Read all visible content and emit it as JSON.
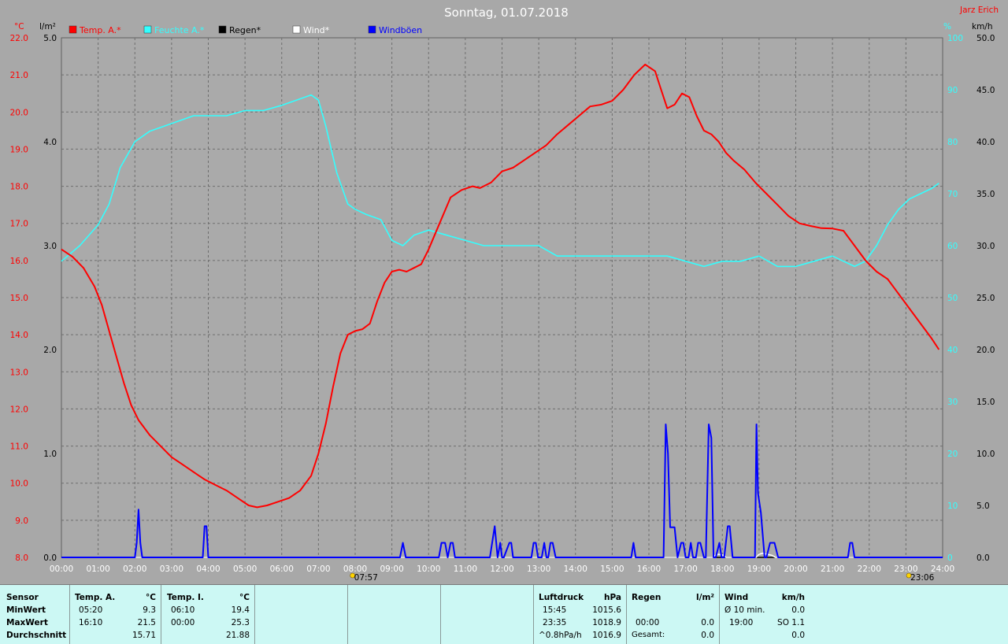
{
  "chart_data": {
    "type": "line",
    "title": "Sonntag, 01.07.2018",
    "author": "Jarz Erich",
    "x_ticks": [
      "00:00",
      "01:00",
      "02:00",
      "03:00",
      "04:00",
      "05:00",
      "06:00",
      "07:00",
      "08:00",
      "09:00",
      "10:00",
      "11:00",
      "12:00",
      "13:00",
      "14:00",
      "15:00",
      "16:00",
      "17:00",
      "18:00",
      "19:00",
      "20:00",
      "21:00",
      "22:00",
      "23:00",
      "24:00"
    ],
    "axes": {
      "temp": {
        "unit": "°C",
        "min": 8.0,
        "max": 22.0,
        "ticks": [
          "8.0",
          "9.0",
          "10.0",
          "11.0",
          "12.0",
          "13.0",
          "14.0",
          "15.0",
          "16.0",
          "17.0",
          "18.0",
          "19.0",
          "20.0",
          "21.0",
          "22.0"
        ],
        "color": "#ff0000"
      },
      "rain": {
        "unit": "l/m²",
        "min": 0.0,
        "max": 5.0,
        "ticks": [
          "0.0",
          "1.0",
          "2.0",
          "3.0",
          "4.0",
          "5.0"
        ],
        "color": "#000000"
      },
      "humidity": {
        "unit": "%",
        "ticks": [
          "0",
          "10",
          "20",
          "30",
          "40",
          "50",
          "60",
          "70",
          "80",
          "90",
          "100"
        ],
        "color": "#33ffff"
      },
      "wind": {
        "unit": "km/h",
        "min": 0.0,
        "max": 50.0,
        "ticks": [
          "0.0",
          "5.0",
          "10.0",
          "15.0",
          "20.0",
          "25.0",
          "30.0",
          "35.0",
          "40.0",
          "45.0",
          "50.0"
        ],
        "color": "#000000"
      }
    },
    "legend": [
      {
        "label": "Temp. A.*",
        "color": "#ff0000"
      },
      {
        "label": "Feuchte A.*",
        "color": "#33ffff"
      },
      {
        "label": "Regen*",
        "color": "#000000"
      },
      {
        "label": "Wind*",
        "color": "#ffffff"
      },
      {
        "label": "Windböen",
        "color": "#0000ff"
      }
    ],
    "sun": {
      "sunrise": "07:57",
      "sunset": "23:06"
    },
    "series": [
      {
        "name": "Temp. A.*",
        "color": "#ff0000",
        "axis": "temp",
        "x": [
          0,
          0.3,
          0.6,
          0.9,
          1.1,
          1.3,
          1.5,
          1.7,
          1.9,
          2.1,
          2.4,
          2.7,
          3,
          3.3,
          3.6,
          3.9,
          4.2,
          4.5,
          4.8,
          5.1,
          5.33,
          5.6,
          5.9,
          6.2,
          6.5,
          6.8,
          7,
          7.2,
          7.4,
          7.6,
          7.8,
          8,
          8.2,
          8.4,
          8.6,
          8.8,
          9,
          9.2,
          9.4,
          9.6,
          9.8,
          10,
          10.3,
          10.6,
          10.9,
          11.2,
          11.4,
          11.7,
          12,
          12.3,
          12.6,
          12.9,
          13.2,
          13.5,
          13.8,
          14.1,
          14.4,
          14.7,
          15,
          15.3,
          15.6,
          15.9,
          16.17,
          16.3,
          16.5,
          16.7,
          16.9,
          17.1,
          17.3,
          17.5,
          17.7,
          17.9,
          18.1,
          18.3,
          18.6,
          18.9,
          19.2,
          19.5,
          19.8,
          20.1,
          20.4,
          20.7,
          21,
          21.3,
          21.6,
          21.9,
          22.2,
          22.5,
          22.8,
          23.1,
          23.4,
          23.7,
          23.9
        ],
        "y": [
          16.3,
          16.1,
          15.8,
          15.3,
          14.8,
          14.1,
          13.4,
          12.7,
          12.1,
          11.7,
          11.3,
          11.0,
          10.7,
          10.5,
          10.3,
          10.1,
          9.95,
          9.8,
          9.6,
          9.4,
          9.35,
          9.4,
          9.5,
          9.6,
          9.8,
          10.2,
          10.8,
          11.6,
          12.6,
          13.5,
          14.0,
          14.1,
          14.15,
          14.3,
          14.9,
          15.4,
          15.7,
          15.75,
          15.7,
          15.8,
          15.9,
          16.3,
          17.0,
          17.7,
          17.9,
          18.0,
          17.95,
          18.1,
          18.4,
          18.5,
          18.7,
          18.9,
          19.1,
          19.4,
          19.65,
          19.9,
          20.15,
          20.2,
          20.3,
          20.6,
          21.0,
          21.28,
          21.1,
          20.7,
          20.1,
          20.2,
          20.5,
          20.4,
          19.9,
          19.5,
          19.4,
          19.2,
          18.9,
          18.7,
          18.45,
          18.1,
          17.8,
          17.5,
          17.2,
          17.0,
          16.93,
          16.87,
          16.86,
          16.8,
          16.4,
          16.0,
          15.7,
          15.5,
          15.1,
          14.7,
          14.3,
          13.9,
          13.6
        ]
      },
      {
        "name": "Feuchte A.*",
        "color": "#33ffff",
        "axis": "humidity",
        "x": [
          0,
          0.5,
          1,
          1.3,
          1.6,
          2,
          2.4,
          2.8,
          3.2,
          3.6,
          4,
          4.5,
          5,
          5.5,
          6,
          6.4,
          6.8,
          7,
          7.2,
          7.5,
          7.8,
          8,
          8.3,
          8.7,
          9,
          9.3,
          9.6,
          10,
          10.5,
          11,
          11.5,
          12,
          12.5,
          13,
          13.5,
          14,
          14.5,
          15,
          15.5,
          16,
          16.5,
          17,
          17.5,
          18,
          18.5,
          19,
          19.5,
          20,
          20.5,
          21,
          21.3,
          21.6,
          21.9,
          22.2,
          22.5,
          22.8,
          23.1,
          23.4,
          23.7,
          23.9
        ],
        "y": [
          57,
          60,
          64,
          68,
          75,
          80,
          82,
          83,
          84,
          85,
          85,
          85,
          86,
          86,
          87,
          88,
          89,
          88,
          83,
          74,
          68,
          67,
          66,
          65,
          61,
          60,
          62,
          63,
          62,
          61,
          60,
          60,
          60,
          60,
          58,
          58,
          58,
          58,
          58,
          58,
          58,
          57,
          56,
          57,
          57,
          58,
          56,
          56,
          57,
          58,
          57,
          56,
          57,
          60,
          64,
          67,
          69,
          70,
          71,
          72
        ]
      },
      {
        "name": "Windböen",
        "color": "#0000ff",
        "axis": "wind",
        "x": [
          0,
          2.0,
          2.05,
          2.1,
          2.15,
          2.2,
          3.85,
          3.9,
          3.95,
          4.0,
          9.22,
          9.3,
          9.38,
          10.28,
          10.35,
          10.45,
          10.52,
          10.6,
          10.66,
          10.72,
          11.67,
          11.8,
          11.88,
          11.95,
          12.0,
          12.05,
          12.2,
          12.25,
          12.3,
          12.8,
          12.86,
          12.92,
          12.98,
          13.08,
          13.15,
          13.21,
          13.26,
          13.32,
          13.38,
          13.46,
          15.52,
          15.58,
          15.64,
          16.4,
          16.46,
          16.52,
          16.58,
          16.7,
          16.78,
          16.88,
          16.94,
          17.0,
          17.08,
          17.14,
          17.2,
          17.28,
          17.34,
          17.4,
          17.5,
          17.55,
          17.63,
          17.7,
          17.76,
          17.82,
          17.92,
          17.98,
          18.05,
          18.15,
          18.2,
          18.28,
          18.32,
          18.89,
          18.93,
          18.97,
          19.05,
          19.15,
          19.2,
          19.3,
          19.38,
          19.42,
          19.52,
          19.62,
          19.72,
          19.78,
          19.82,
          21.42,
          21.48,
          21.54,
          21.6,
          21.66,
          24
        ],
        "y": [
          0,
          0,
          1.4,
          4.6,
          1.4,
          0,
          0,
          3,
          3,
          0,
          0,
          1.4,
          0,
          0,
          1.4,
          1.4,
          0,
          1.4,
          1.4,
          0,
          0,
          3,
          0,
          1.4,
          0,
          0,
          1.4,
          1.4,
          0,
          0,
          1.4,
          1.4,
          0,
          0,
          1.4,
          0,
          0,
          1.4,
          1.4,
          0,
          0,
          1.4,
          0,
          0,
          12.8,
          10,
          2.9,
          2.9,
          0,
          1.4,
          1.4,
          0,
          0,
          1.4,
          0,
          0,
          1.4,
          1.4,
          0,
          0,
          12.8,
          11.5,
          0,
          0,
          1.4,
          0,
          0,
          3,
          3,
          0,
          0,
          0,
          12.8,
          6.2,
          4.3,
          0,
          0,
          1.4,
          1.4,
          1.4,
          0,
          0,
          0,
          0,
          0,
          0,
          1.4,
          1.4,
          0,
          0,
          0
        ]
      },
      {
        "name": "Wind*",
        "color": "#ffffff",
        "axis": "wind",
        "x": [
          0,
          17.75,
          17.8,
          17.9,
          18.05,
          18.1,
          18.92,
          19.0,
          19.1,
          19.35,
          19.45,
          24
        ],
        "y": [
          0,
          0,
          0.2,
          0.3,
          0.2,
          0,
          0,
          0.3,
          0.4,
          0.2,
          0,
          0
        ]
      },
      {
        "name": "Regen*",
        "color": "#000000",
        "axis": "rain",
        "x": [
          0,
          24
        ],
        "y": [
          0,
          0
        ]
      }
    ]
  },
  "stats": {
    "temp_a": {
      "header": "Temp. A.",
      "unit": "°C",
      "min_time": "05:20",
      "min_val": "9.3",
      "max_time": "16:10",
      "max_val": "21.5",
      "avg_val": "15.71"
    },
    "temp_i": {
      "header": "Temp. I.",
      "unit": "°C",
      "min_time": "06:10",
      "min_val": "19.4",
      "max_time": "00:00",
      "max_val": "25.3",
      "avg_val": "21.88"
    },
    "row_labels": {
      "sensor": "Sensor",
      "min": "MinWert",
      "max": "MaxWert",
      "avg": "Durchschnitt"
    },
    "pressure": {
      "header": "Luftdruck",
      "unit": "hPa",
      "min_time": "15:45",
      "min_val": "1015.6",
      "max_time": "23:35",
      "max_val": "1018.9",
      "trend_label": "^0.8hPa/h",
      "trend_val": "1016.9"
    },
    "rain": {
      "header": "Regen",
      "unit": "l/m²",
      "max_time": "00:00",
      "max_val": "0.0",
      "total_label": "Gesamt:",
      "total_val": "0.0",
      "min_val": "0.0"
    },
    "wind": {
      "header": "Wind",
      "unit": "km/h",
      "avg_label": "Ø 10 min.",
      "avg_val": "0.0",
      "max_time": "19:00",
      "max_val": "SO 1.1",
      "last_val": "0.0"
    }
  }
}
